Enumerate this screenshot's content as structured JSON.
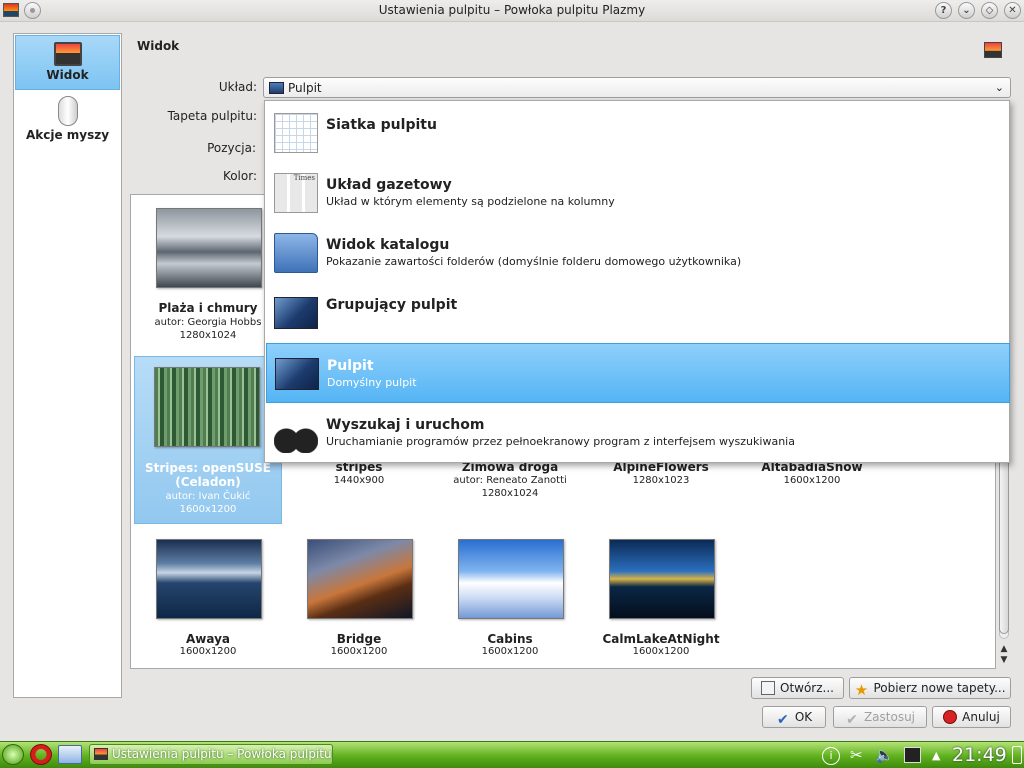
{
  "window": {
    "title": "Ustawienia pulpitu – Powłoka pulpitu Plazmy",
    "buttons": [
      "?",
      "⌄",
      "◇",
      "✕"
    ]
  },
  "sidebar": {
    "items": [
      {
        "label": "Widok",
        "icon": "monitor-icon",
        "active": true
      },
      {
        "label": "Akcje myszy",
        "icon": "mouse-icon",
        "active": false
      }
    ]
  },
  "main": {
    "section_title": "Widok",
    "labels": {
      "layout": "Układ:",
      "wallpaper": "Tapeta pulpitu:",
      "position": "Pozycja:",
      "color": "Kolor:"
    },
    "layout_combo": {
      "value": "Pulpit",
      "icon": "desktop-icon"
    }
  },
  "layout_popup": {
    "items": [
      {
        "title": "Siatka pulpitu",
        "desc": "",
        "icon": "grid-icon"
      },
      {
        "title": "Układ gazetowy",
        "desc": "Układ w którym elementy są podzielone na kolumny",
        "icon": "newspaper-icon",
        "icon_text": "Times"
      },
      {
        "title": "Widok katalogu",
        "desc": "Pokazanie zawartości folderów (domyślnie folderu domowego użytkownika)",
        "icon": "folder-icon"
      },
      {
        "title": "Grupujący pulpit",
        "desc": "",
        "icon": "desktop-icon"
      },
      {
        "title": "Pulpit",
        "desc": "Domyślny pulpit",
        "icon": "desktop-icon",
        "selected": true
      },
      {
        "title": "Wyszukaj i uruchom",
        "desc": "Uruchamianie programów przez pełnoekranowy program z interfejsem wyszukiwania",
        "icon": "binoculars-icon"
      }
    ]
  },
  "wallpapers": [
    {
      "name": "Plaża i chmury",
      "author": "autor: Georgia Hobbs",
      "size": "1280x1024"
    },
    {
      "name": "Stripes: openSUSE (Celadon)",
      "author": "autor: Ivan Čukić",
      "size": "1600x1200",
      "selected": true
    },
    {
      "name": "stripes",
      "author": "",
      "size": "1440x900"
    },
    {
      "name": "Zimowa droga",
      "author": "autor: Reneato Zanotti",
      "size": "1280x1024"
    },
    {
      "name": "AlpineFlowers",
      "author": "",
      "size": "1280x1023"
    },
    {
      "name": "AltabadiaSnow",
      "author": "",
      "size": "1600x1200"
    },
    {
      "name": "Awaya",
      "author": "",
      "size": "1600x1200"
    },
    {
      "name": "Bridge",
      "author": "",
      "size": "1600x1200"
    },
    {
      "name": "Cabins",
      "author": "",
      "size": "1600x1200"
    },
    {
      "name": "CalmLakeAtNight",
      "author": "",
      "size": "1600x1200"
    }
  ],
  "buttons": {
    "open": "Otwórz...",
    "get_new": "Pobierz nowe tapety...",
    "ok": "OK",
    "apply": "Zastosuj",
    "cancel": "Anuluj"
  },
  "taskbar": {
    "task_label": "Ustawienia pulpitu – Powłoka pulpitu P",
    "clock": "21:49"
  }
}
